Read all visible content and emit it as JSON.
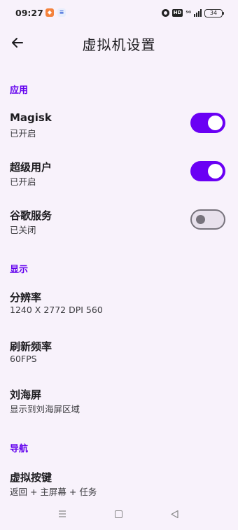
{
  "status_bar": {
    "time": "09:27",
    "network": "⁵ᴳ",
    "battery": "34"
  },
  "header": {
    "title": "虚拟机设置"
  },
  "sections": {
    "apps": {
      "title": "应用",
      "magisk": {
        "label": "Magisk",
        "status": "已开启",
        "enabled": true
      },
      "superuser": {
        "label": "超级用户",
        "status": "已开启",
        "enabled": true
      },
      "google": {
        "label": "谷歌服务",
        "status": "已关闭",
        "enabled": false
      }
    },
    "display": {
      "title": "显示",
      "resolution": {
        "label": "分辨率",
        "value": "1240 X 2772 DPI 560"
      },
      "refresh": {
        "label": "刷新频率",
        "value": "60FPS"
      },
      "notch": {
        "label": "刘海屏",
        "value": "显示到刘海屏区域"
      }
    },
    "navigation": {
      "title": "导航",
      "virtual_keys": {
        "label": "虚拟按键",
        "value": "返回 + 主屏幕 + 任务"
      }
    }
  },
  "colors": {
    "accent": "#6200ee",
    "switch_on": "#6a00f4",
    "background": "#f8f2fb"
  }
}
